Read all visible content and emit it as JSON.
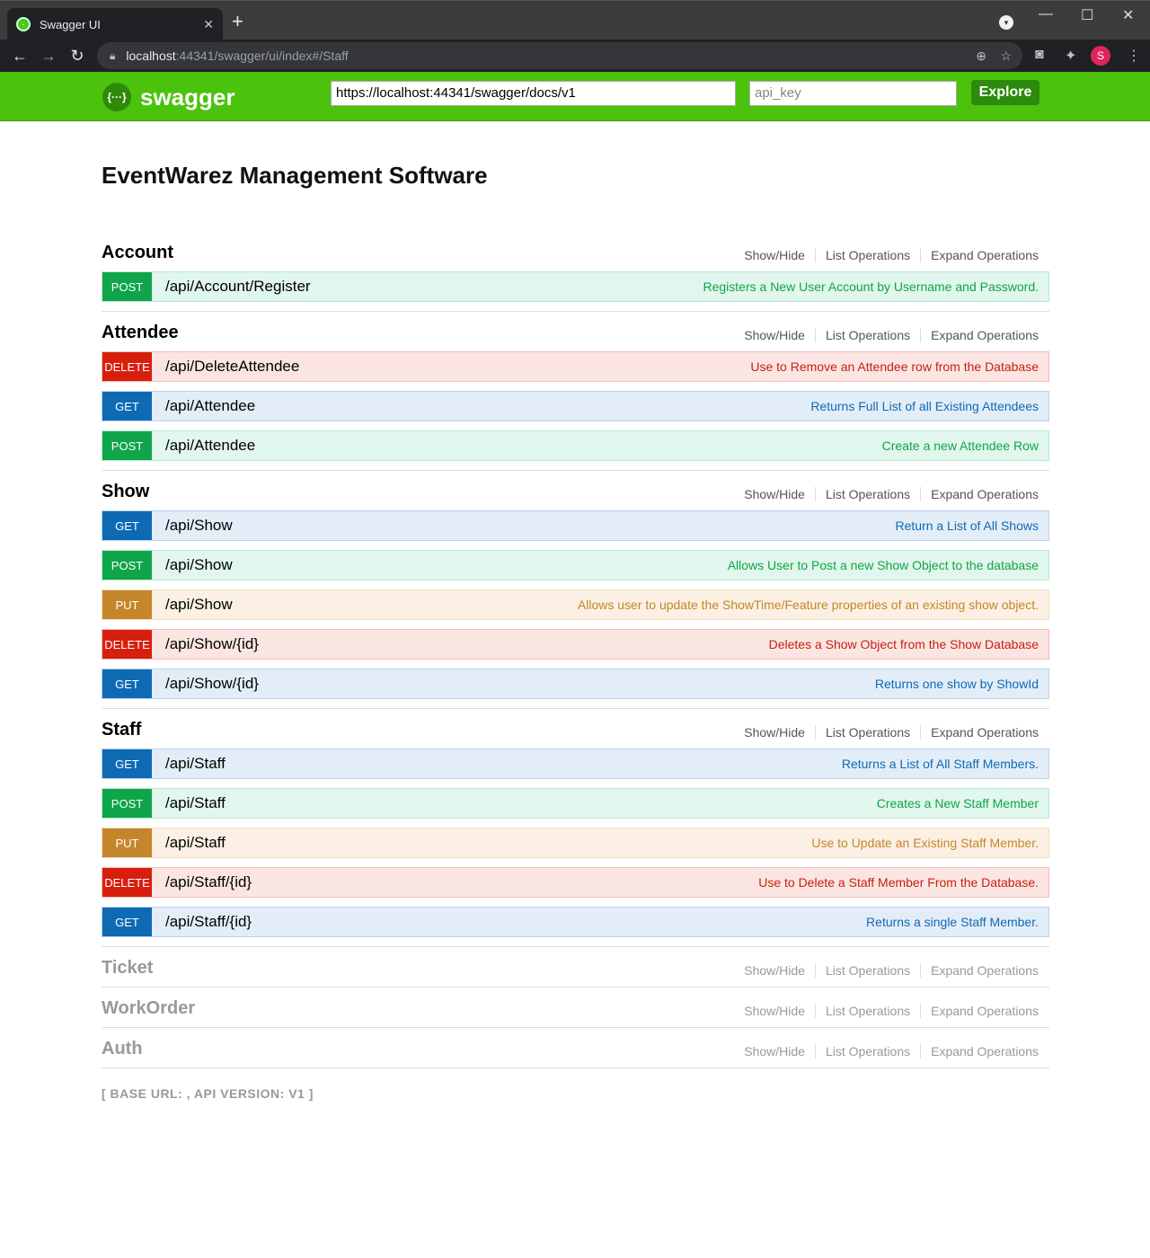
{
  "browser": {
    "tab_title": "Swagger UI",
    "tab_close": "✕",
    "new_tab": "+",
    "url_host": "localhost",
    "url_path": ":44341/swagger/ui/index#/Staff",
    "profile_initial": "S"
  },
  "swagger": {
    "logo_text": "swagger",
    "logo_glyph": "{···}",
    "url_value": "https://localhost:44341/swagger/docs/v1",
    "api_key_placeholder": "api_key",
    "explore_label": "Explore"
  },
  "page": {
    "title": "EventWarez Management Software"
  },
  "resource_links": {
    "show_hide": "Show/Hide",
    "list_ops": "List Operations",
    "expand_ops": "Expand Operations"
  },
  "resources": [
    {
      "name": "Account",
      "ops": [
        {
          "method": "POST",
          "path": "/api/Account/Register",
          "summary": "Registers a New User Account by Username and Password."
        }
      ]
    },
    {
      "name": "Attendee",
      "ops": [
        {
          "method": "DELETE",
          "path": "/api/DeleteAttendee",
          "summary": "Use to Remove an Attendee row from the Database"
        },
        {
          "method": "GET",
          "path": "/api/Attendee",
          "summary": "Returns Full List of all Existing Attendees"
        },
        {
          "method": "POST",
          "path": "/api/Attendee",
          "summary": "Create a new Attendee Row"
        }
      ]
    },
    {
      "name": "Show",
      "ops": [
        {
          "method": "GET",
          "path": "/api/Show",
          "summary": "Return a List of All Shows"
        },
        {
          "method": "POST",
          "path": "/api/Show",
          "summary": "Allows User to Post a new Show Object to the database"
        },
        {
          "method": "PUT",
          "path": "/api/Show",
          "summary": "Allows user to update the ShowTime/Feature properties of an existing show object."
        },
        {
          "method": "DELETE",
          "path": "/api/Show/{id}",
          "summary": "Deletes a Show Object from the Show Database"
        },
        {
          "method": "GET",
          "path": "/api/Show/{id}",
          "summary": "Returns one show by ShowId"
        }
      ]
    },
    {
      "name": "Staff",
      "ops": [
        {
          "method": "GET",
          "path": "/api/Staff",
          "summary": "Returns a List of All Staff Members."
        },
        {
          "method": "POST",
          "path": "/api/Staff",
          "summary": "Creates a New Staff Member"
        },
        {
          "method": "PUT",
          "path": "/api/Staff",
          "summary": "Use to Update an Existing Staff Member."
        },
        {
          "method": "DELETE",
          "path": "/api/Staff/{id}",
          "summary": "Use to Delete a Staff Member From the Database."
        },
        {
          "method": "GET",
          "path": "/api/Staff/{id}",
          "summary": "Returns a single Staff Member."
        }
      ]
    },
    {
      "name": "Ticket",
      "collapsed": true,
      "ops": []
    },
    {
      "name": "WorkOrder",
      "collapsed": true,
      "ops": []
    },
    {
      "name": "Auth",
      "collapsed": true,
      "ops": []
    }
  ],
  "footer": {
    "text": "[ BASE URL: , API VERSION: V1 ]"
  },
  "colors": {
    "swagger_green": "#4bc30d",
    "post": "#10a54a",
    "get": "#0f6ab4",
    "delete": "#d81f0e",
    "put": "#c5862b"
  }
}
